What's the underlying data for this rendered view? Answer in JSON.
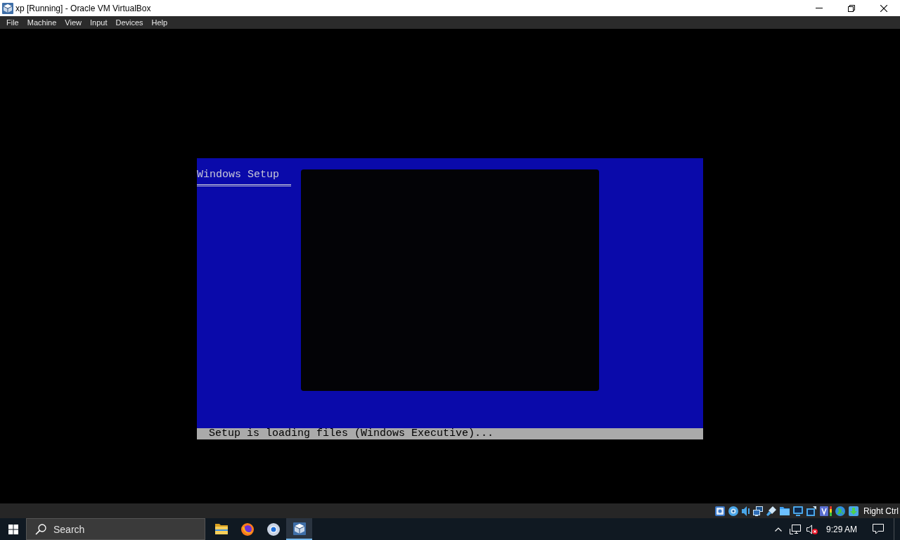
{
  "window": {
    "title": "xp [Running] - Oracle VM VirtualBox"
  },
  "menu": [
    "File",
    "Machine",
    "View",
    "Input",
    "Devices",
    "Help"
  ],
  "vm_screen": {
    "heading": "Windows Setup",
    "status": "Setup is loading files (Windows Executive)..."
  },
  "status_bar": {
    "host_key": "Right Ctrl"
  },
  "taskbar": {
    "search": {
      "placeholder": "Search"
    },
    "apps": [
      {
        "kind": "folder",
        "selected": false
      },
      {
        "kind": "fox",
        "selected": false
      },
      {
        "kind": "ring",
        "selected": false
      },
      {
        "kind": "cube",
        "selected": true
      }
    ]
  },
  "tray": {
    "volume_muted": true,
    "clock": "9:29 AM"
  }
}
